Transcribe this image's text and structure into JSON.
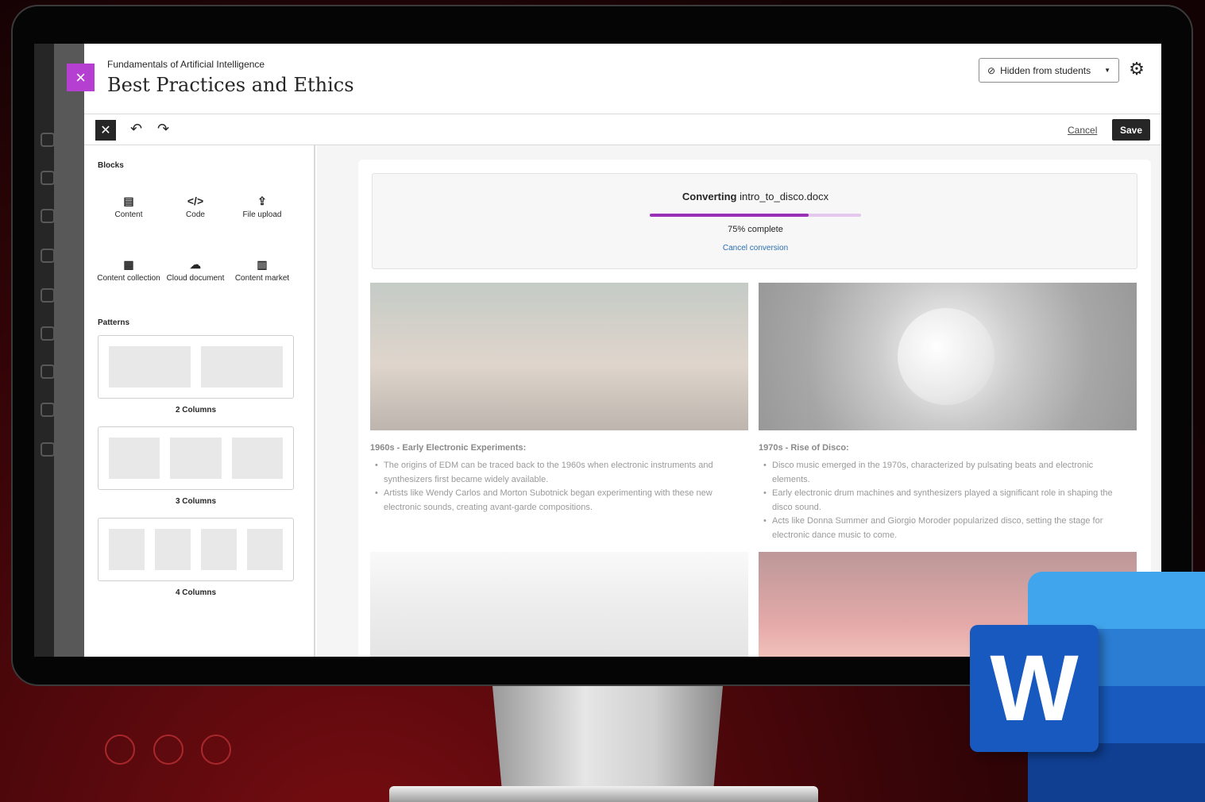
{
  "header": {
    "course_name": "Fundamentals of Artificial Intelligence",
    "page_title": "Best Practices and Ethics",
    "visibility_label": "Hidden from students"
  },
  "toolbar": {
    "cancel_label": "Cancel",
    "save_label": "Save"
  },
  "blocks_panel": {
    "blocks_heading": "Blocks",
    "blocks": [
      {
        "label": "Content",
        "icon": "content-icon"
      },
      {
        "label": "Code",
        "icon": "code-icon"
      },
      {
        "label": "File upload",
        "icon": "file-upload-icon"
      },
      {
        "label": "Content collection",
        "icon": "content-collection-icon"
      },
      {
        "label": "Cloud document",
        "icon": "cloud-document-icon"
      },
      {
        "label": "Content market",
        "icon": "content-market-icon"
      }
    ],
    "patterns_heading": "Patterns",
    "patterns": [
      {
        "label": "2 Columns",
        "columns": 2
      },
      {
        "label": "3 Columns",
        "columns": 3
      },
      {
        "label": "4 Columns",
        "columns": 4
      }
    ]
  },
  "conversion": {
    "prefix": "Converting",
    "file_name": "intro_to_disco.docx",
    "progress_percent": 75,
    "progress_text": "75% complete",
    "cancel_label": "Cancel conversion",
    "progress_color": "#9a2fb8"
  },
  "document": {
    "sections": [
      {
        "heading": "1960s - Early Electronic Experiments:",
        "bullets": [
          "The origins of EDM can be traced back to the 1960s when electronic instruments and synthesizers first became widely available.",
          "Artists like Wendy Carlos and Morton Subotnick began experimenting with these new electronic sounds, creating avant-garde compositions."
        ]
      },
      {
        "heading": "1970s - Rise of Disco:",
        "bullets": [
          "Disco music emerged in the 1970s, characterized by pulsating beats and electronic elements.",
          "Early electronic drum machines and synthesizers played a significant role in shaping the disco sound.",
          "Acts like Donna Summer and Giorgio Moroder popularized disco, setting the stage for electronic dance music to come."
        ]
      }
    ]
  },
  "logo": {
    "letter": "W"
  },
  "colors": {
    "accent": "#b43fd0",
    "word_blue": "#185abd"
  }
}
